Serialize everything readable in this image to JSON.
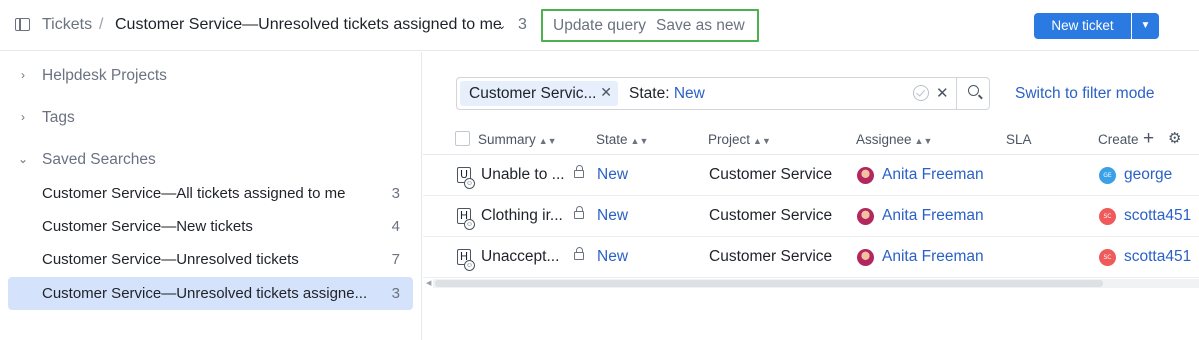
{
  "header": {
    "breadcrumb": "Tickets",
    "separator": "/",
    "title": "Customer Service—Unresolved tickets assigned to me",
    "count": "3",
    "update_query": "Update query",
    "save_as_new": "Save as new",
    "new_ticket": "New ticket"
  },
  "sidebar": {
    "groups": [
      {
        "label": "Helpdesk Projects",
        "expanded": false
      },
      {
        "label": "Tags",
        "expanded": false
      },
      {
        "label": "Saved Searches",
        "expanded": true
      }
    ],
    "saved_searches": [
      {
        "label": "Customer Service—All tickets assigned to me",
        "count": "3"
      },
      {
        "label": "Customer Service—New tickets",
        "count": "4"
      },
      {
        "label": "Customer Service—Unresolved tickets",
        "count": "7"
      },
      {
        "label": "Customer Service—Unresolved tickets assigne...",
        "count": "3",
        "selected": true
      }
    ]
  },
  "search": {
    "chip_label": "Customer Servic...",
    "state_label": "State:",
    "state_value": "New",
    "switch_mode": "Switch to filter mode"
  },
  "table": {
    "columns": [
      "Summary",
      "State",
      "Project",
      "Assignee",
      "SLA",
      "Create"
    ],
    "rows": [
      {
        "type": "U",
        "summary": "Unable to ...",
        "state": "New",
        "project": "Customer Service",
        "assignee": "Anita Freeman",
        "creator_initials": "GE",
        "creator": "george",
        "creator_color": "#3aa0e8"
      },
      {
        "type": "H",
        "summary": "Clothing ir...",
        "state": "New",
        "project": "Customer Service",
        "assignee": "Anita Freeman",
        "creator_initials": "SC",
        "creator": "scotta451",
        "creator_color": "#ef5a5a"
      },
      {
        "type": "H",
        "summary": "Unaccept...",
        "state": "New",
        "project": "Customer Service",
        "assignee": "Anita Freeman",
        "creator_initials": "SC",
        "creator": "scotta451",
        "creator_color": "#ef5a5a"
      }
    ]
  },
  "colors": {
    "accent": "#2a7ae2",
    "link": "#2a61c7",
    "selected_bg": "#d4e2fb",
    "highlight_border": "#4caf50"
  }
}
